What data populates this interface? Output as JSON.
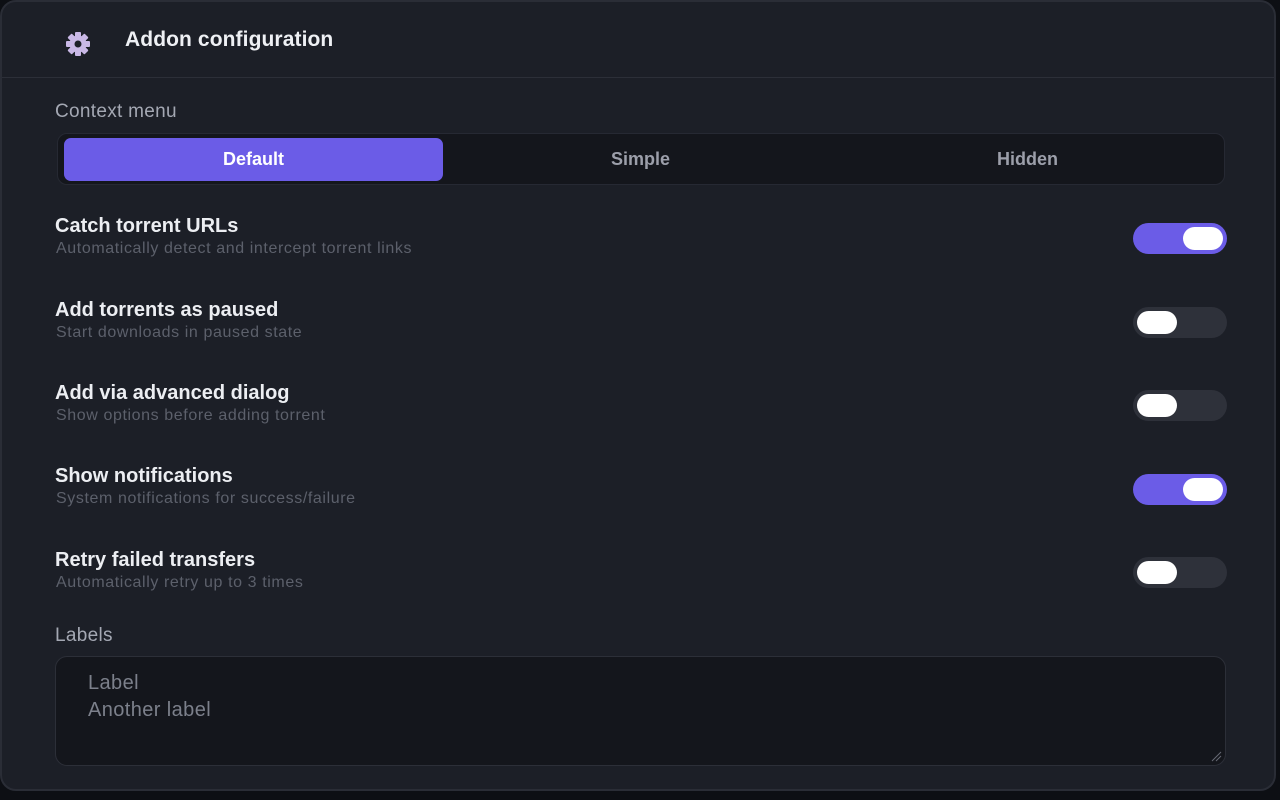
{
  "header": {
    "title": "Addon configuration",
    "icon": "gear-icon"
  },
  "context_menu": {
    "label": "Context menu",
    "options": [
      "Default",
      "Simple",
      "Hidden"
    ],
    "selected": "Default"
  },
  "settings": [
    {
      "title": "Catch torrent URLs",
      "description": "Automatically detect and intercept torrent links",
      "enabled": true
    },
    {
      "title": "Add torrents as paused",
      "description": "Start downloads in paused state",
      "enabled": false
    },
    {
      "title": "Add via advanced dialog",
      "description": "Show options before adding torrent",
      "enabled": false
    },
    {
      "title": "Show notifications",
      "description": "System notifications for success/failure",
      "enabled": true
    },
    {
      "title": "Retry failed transfers",
      "description": "Automatically retry up to 3 times",
      "enabled": false
    }
  ],
  "labels": {
    "label": "Labels",
    "values": [
      "Label",
      "Another label"
    ]
  },
  "colors": {
    "accent": "#6b5ce7",
    "background": "#1c1f27",
    "toggle_off": "#2e313a"
  }
}
